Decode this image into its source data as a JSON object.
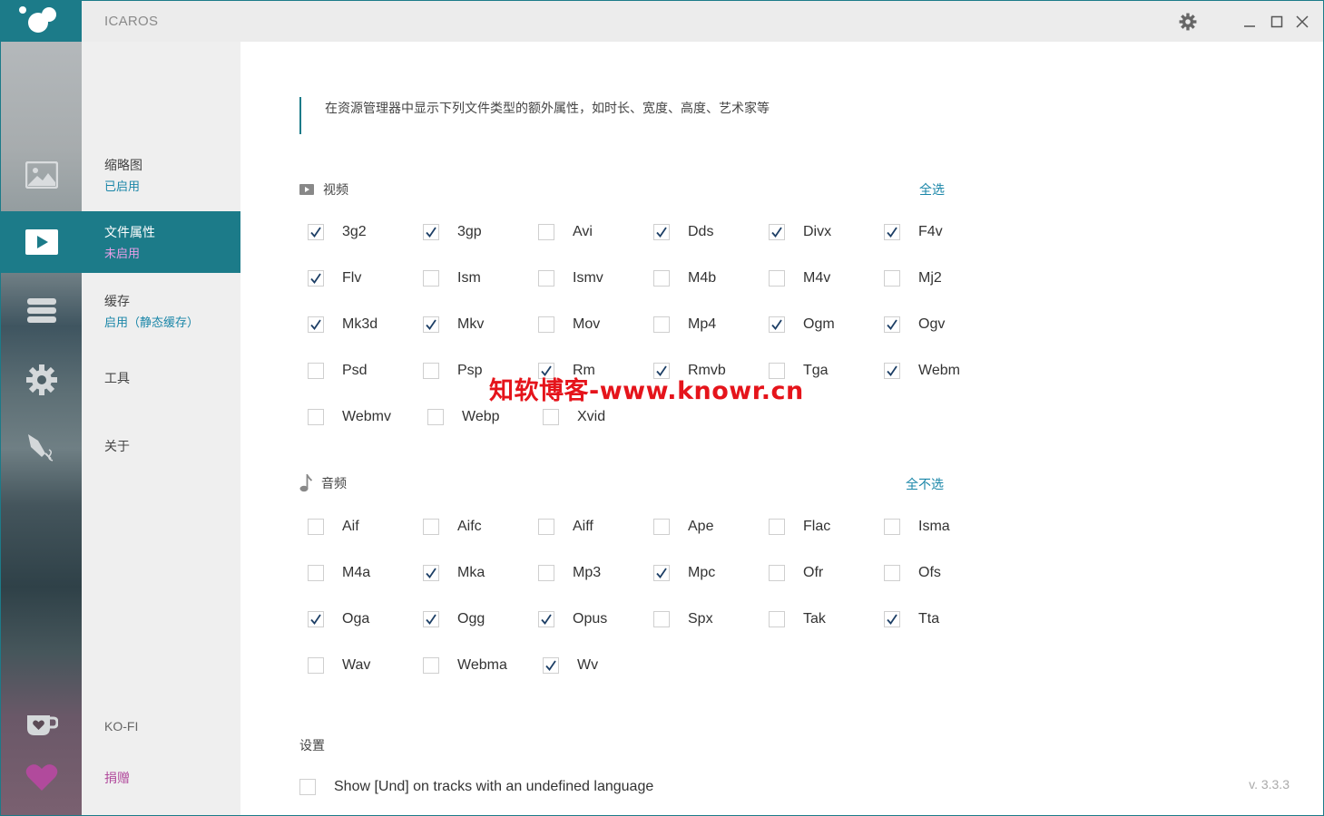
{
  "window": {
    "title": "ICAROS",
    "accent": "#1c7b89"
  },
  "rail": {
    "icons": [
      "image-icon",
      "play-icon",
      "stack-icon",
      "gear-icon",
      "pen-icon",
      "kofi-cup-icon",
      "heart-icon"
    ]
  },
  "nav": {
    "thumbnails": {
      "title": "缩略图",
      "status": "已启用"
    },
    "properties": {
      "title": "文件属性",
      "status": "未启用"
    },
    "cache": {
      "title": "缓存",
      "status": "启用（静态缓存）"
    },
    "tools": {
      "title": "工具"
    },
    "about": {
      "title": "关于"
    },
    "kofi": {
      "title": "KO-FI"
    },
    "donate": {
      "title": "捐赠"
    }
  },
  "main": {
    "description": "在资源管理器中显示下列文件类型的额外属性，如时长、宽度、高度、艺术家等",
    "video": {
      "heading": "视频",
      "toggle_label": "全选",
      "rows": [
        [
          {
            "label": "3g2",
            "checked": true
          },
          {
            "label": "3gp",
            "checked": true
          },
          {
            "label": "Avi",
            "checked": false
          },
          {
            "label": "Dds",
            "checked": true
          },
          {
            "label": "Divx",
            "checked": true
          },
          {
            "label": "F4v",
            "checked": true
          }
        ],
        [
          {
            "label": "Flv",
            "checked": true
          },
          {
            "label": "Ism",
            "checked": false
          },
          {
            "label": "Ismv",
            "checked": false
          },
          {
            "label": "M4b",
            "checked": false
          },
          {
            "label": "M4v",
            "checked": false
          },
          {
            "label": "Mj2",
            "checked": false
          }
        ],
        [
          {
            "label": "Mk3d",
            "checked": true
          },
          {
            "label": "Mkv",
            "checked": true
          },
          {
            "label": "Mov",
            "checked": false
          },
          {
            "label": "Mp4",
            "checked": false
          },
          {
            "label": "Ogm",
            "checked": true
          },
          {
            "label": "Ogv",
            "checked": true
          }
        ],
        [
          {
            "label": "Psd",
            "checked": false
          },
          {
            "label": "Psp",
            "checked": false
          },
          {
            "label": "Rm",
            "checked": true
          },
          {
            "label": "Rmvb",
            "checked": true
          },
          {
            "label": "Tga",
            "checked": false
          },
          {
            "label": "Webm",
            "checked": true
          }
        ],
        [
          {
            "label": "Webmv",
            "checked": false
          },
          {
            "label": "Webp",
            "checked": false
          },
          {
            "label": "Xvid",
            "checked": false
          }
        ]
      ]
    },
    "audio": {
      "heading": "音频",
      "toggle_label": "全不选",
      "rows": [
        [
          {
            "label": "Aif",
            "checked": false
          },
          {
            "label": "Aifc",
            "checked": false
          },
          {
            "label": "Aiff",
            "checked": false
          },
          {
            "label": "Ape",
            "checked": false
          },
          {
            "label": "Flac",
            "checked": false
          },
          {
            "label": "Isma",
            "checked": false
          }
        ],
        [
          {
            "label": "M4a",
            "checked": false
          },
          {
            "label": "Mka",
            "checked": true
          },
          {
            "label": "Mp3",
            "checked": false
          },
          {
            "label": "Mpc",
            "checked": true
          },
          {
            "label": "Ofr",
            "checked": false
          },
          {
            "label": "Ofs",
            "checked": false
          }
        ],
        [
          {
            "label": "Oga",
            "checked": true
          },
          {
            "label": "Ogg",
            "checked": true
          },
          {
            "label": "Opus",
            "checked": true
          },
          {
            "label": "Spx",
            "checked": false
          },
          {
            "label": "Tak",
            "checked": false
          },
          {
            "label": "Tta",
            "checked": true
          }
        ],
        [
          {
            "label": "Wav",
            "checked": false
          },
          {
            "label": "Webma",
            "checked": false
          },
          {
            "label": "Wv",
            "checked": true
          }
        ]
      ]
    },
    "settings": {
      "heading": "设置",
      "und_option": {
        "label": "Show [Und] on tracks with an undefined language",
        "checked": false
      }
    },
    "version": "v. 3.3.3"
  },
  "watermark": "知软博客-www.knowr.cn"
}
